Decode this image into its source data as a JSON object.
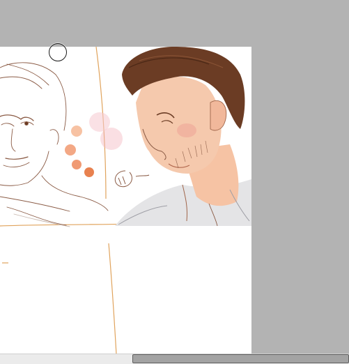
{
  "app": {
    "canvas_background": "#ffffff",
    "workspace_background": "#b3b3b3"
  },
  "brush_cursor": {
    "icon": "circle-brush-cursor-icon"
  },
  "artwork": {
    "palette_swatches": [
      "#f7c2a3",
      "#f3a885",
      "#f09a73",
      "#e8814f"
    ],
    "guide_line_color": "#e0a35c",
    "sketch_line_color": "#8a5a44",
    "hair_color": "#6b3c24",
    "skin_color": "#f4c4a6",
    "shirt_color": "#e4e4e6"
  },
  "scrollbar": {
    "orientation": "horizontal",
    "thumb_fraction": 0.62,
    "thumb_start_fraction": 0.38
  }
}
